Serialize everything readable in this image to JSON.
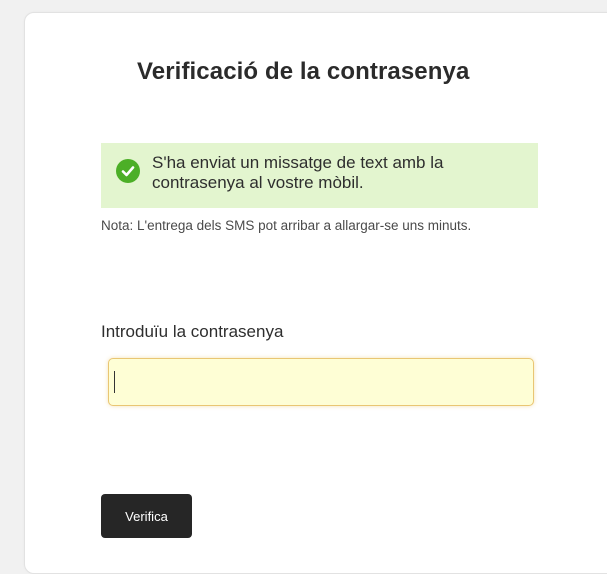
{
  "page": {
    "title": "Verificació de la contrasenya"
  },
  "alert": {
    "message": "S'ha enviat un missatge de text amb la contrasenya al vostre mòbil.",
    "icon": "check-circle-icon",
    "background": "#e3f5cf",
    "icon_color": "#4caf27"
  },
  "note": {
    "text": "Nota: L'entrega dels SMS pot arribar a allargar-se uns minuts."
  },
  "form": {
    "password_label": "Introduïu la contrasenya",
    "password_value": "",
    "submit_label": "Verifica"
  }
}
